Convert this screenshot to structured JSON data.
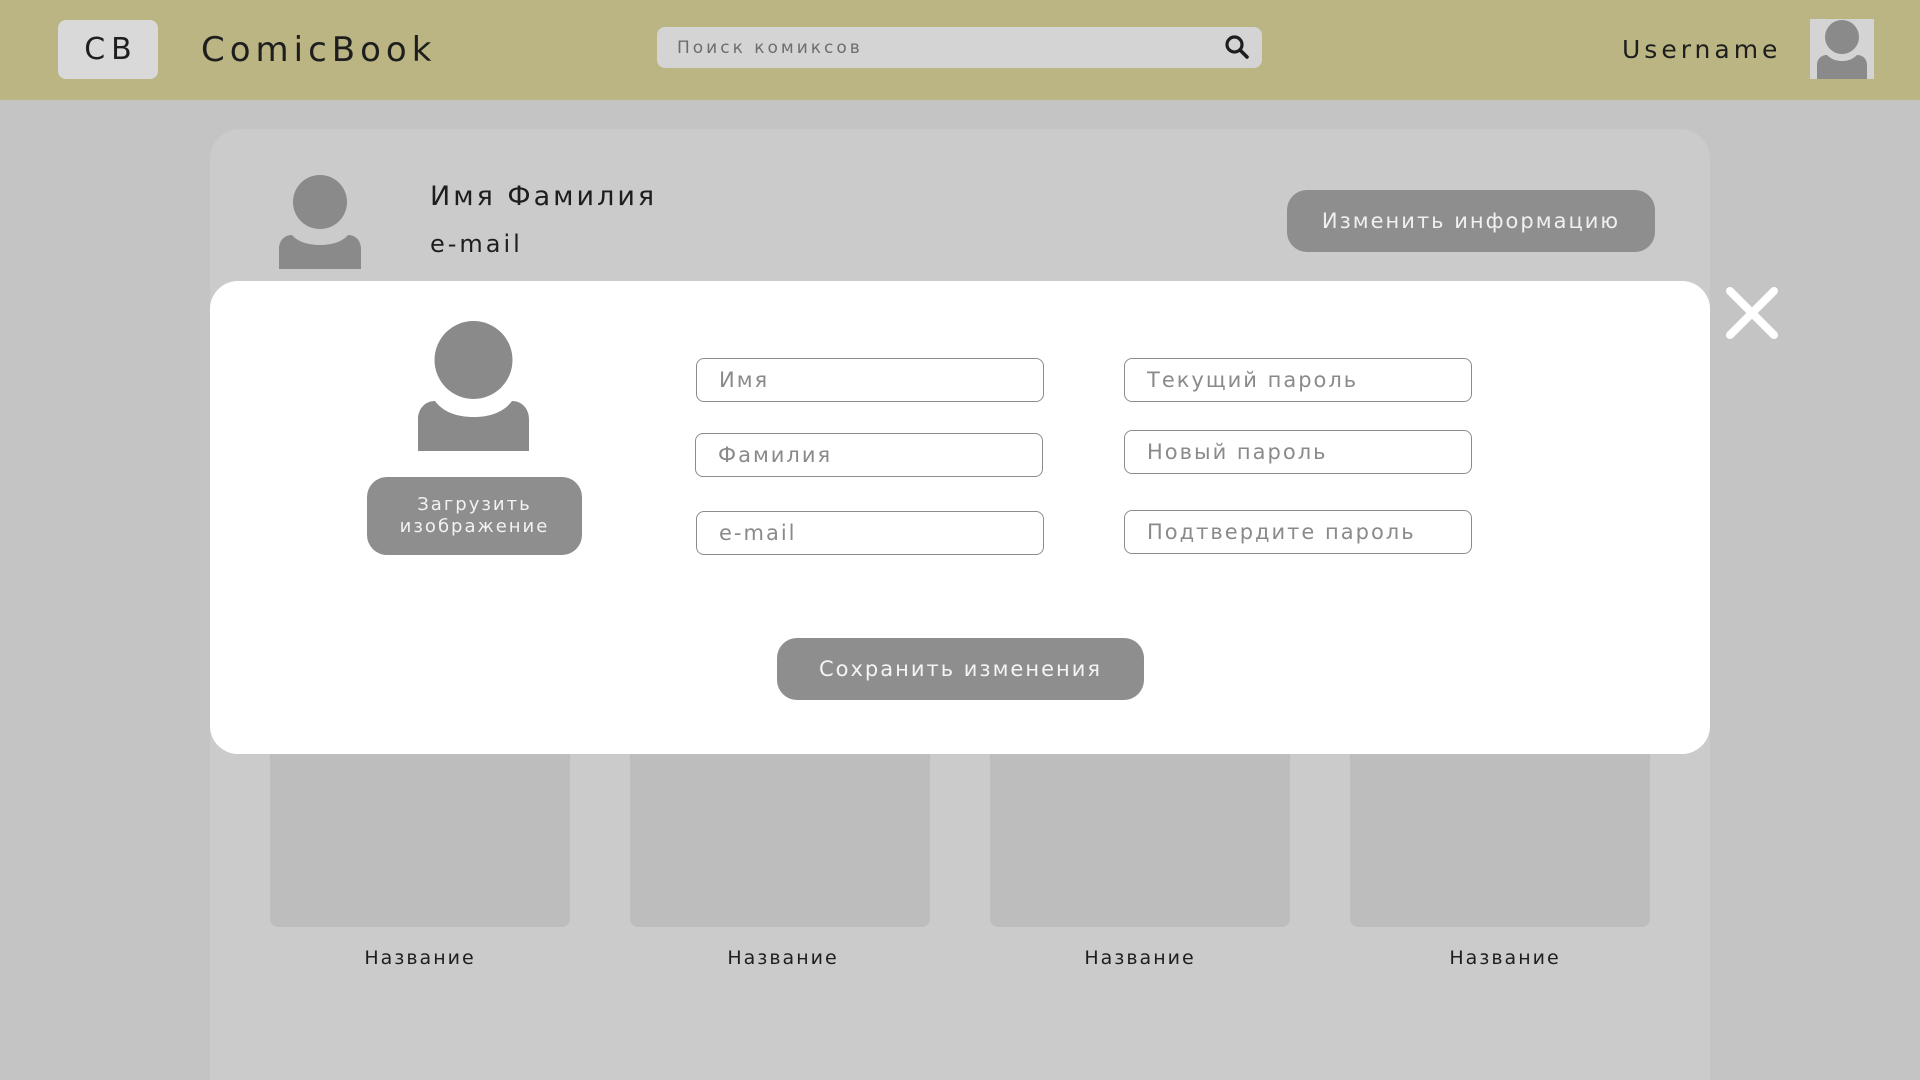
{
  "header": {
    "logo": "CB",
    "app_title": "ComicBook",
    "search_placeholder": "Поиск комиксов",
    "username": "Username"
  },
  "profile": {
    "name": "Имя Фамилия",
    "email": "e-mail",
    "edit_button": "Изменить информацию"
  },
  "comics": [
    {
      "title": "Название"
    },
    {
      "title": "Название"
    },
    {
      "title": "Название"
    },
    {
      "title": "Название"
    }
  ],
  "modal": {
    "upload_button": "Загрузить\nизображение",
    "fields": {
      "first_name": "Имя",
      "last_name": "Фамилия",
      "email": "e-mail",
      "current_password": "Текущий пароль",
      "new_password": "Новый пароль",
      "confirm_password": "Подтвердите пароль"
    },
    "save_button": "Сохранить изменения"
  },
  "icons": {
    "search": "search-icon",
    "close": "close-icon",
    "avatar": "user-avatar-icon"
  },
  "colors": {
    "header_bg": "#bab582",
    "page_bg": "#c4c4c4",
    "button_bg": "#8e8e8e",
    "modal_bg": "#ffffff"
  }
}
